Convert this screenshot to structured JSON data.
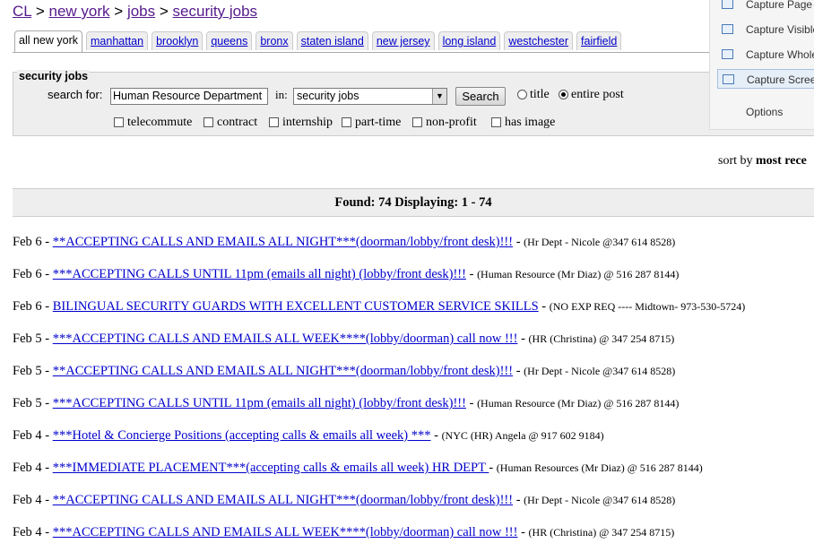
{
  "breadcrumb": {
    "items": [
      "CL",
      "new york",
      "jobs",
      "security jobs"
    ],
    "separator": ">"
  },
  "tabs": [
    {
      "label": "all new york",
      "active": true
    },
    {
      "label": "manhattan"
    },
    {
      "label": "brooklyn"
    },
    {
      "label": "queens"
    },
    {
      "label": "bronx"
    },
    {
      "label": "staten island"
    },
    {
      "label": "new jersey"
    },
    {
      "label": "long island"
    },
    {
      "label": "westchester"
    },
    {
      "label": "fairfield"
    }
  ],
  "search": {
    "panel_title": "security jobs",
    "label": "search for:",
    "query": "Human Resource Department",
    "in_label": "in:",
    "category": "security jobs",
    "button": "Search",
    "radio_title": "title",
    "radio_entire": "entire post",
    "selected_radio": "entire post",
    "filters": [
      "telecommute",
      "contract",
      "internship",
      "part-time",
      "non-profit",
      "has image"
    ]
  },
  "capture_menu": {
    "items": [
      "Capture Page",
      "Capture Visible",
      "Capture Whole",
      "Capture Screen"
    ],
    "options": "Options"
  },
  "sort": {
    "label": "sort by",
    "value": "most rece"
  },
  "found": "Found: 74 Displaying: 1 - 74",
  "listings": [
    {
      "date": "Feb 6",
      "title": "**ACCEPTING CALLS AND EMAILS ALL NIGHT***(doorman/lobby/front desk)!!!",
      "poster": "(Hr Dept - Nicole @347 614 8528)"
    },
    {
      "date": "Feb 6",
      "title": "***ACCEPTING CALLS UNTIL 11pm (emails all night) (lobby/front desk)!!!",
      "poster": "(Human Resource (Mr Diaz) @ 516 287 8144)"
    },
    {
      "date": "Feb 6",
      "title": "BILINGUAL SECURITY GUARDS WITH EXCELLENT CUSTOMER SERVICE SKILLS",
      "poster": "(NO EXP REQ ---- Midtown- 973-530-5724)"
    },
    {
      "date": "Feb 5",
      "title": "***ACCEPTING CALLS AND EMAILS ALL WEEK****(lobby/doorman) call now !!!",
      "poster": "(HR (Christina) @ 347 254 8715)"
    },
    {
      "date": "Feb 5",
      "title": "**ACCEPTING CALLS AND EMAILS ALL NIGHT***(doorman/lobby/front desk)!!!",
      "poster": "(Hr Dept - Nicole @347 614 8528)"
    },
    {
      "date": "Feb 5",
      "title": "***ACCEPTING CALLS UNTIL 11pm (emails all night) (lobby/front desk)!!!",
      "poster": "(Human Resource (Mr Diaz) @ 516 287 8144)"
    },
    {
      "date": "Feb 4",
      "title": "***Hotel & Concierge Positions (accepting calls & emails all week) ***",
      "poster": "(NYC (HR) Angela @ 917 602 9184)"
    },
    {
      "date": "Feb 4",
      "title": "***IMMEDIATE PLACEMENT***(accepting calls & emails all week) HR DEPT ",
      "poster": "(Human Resources (Mr Diaz) @ 516 287 8144)"
    },
    {
      "date": "Feb 4",
      "title": "**ACCEPTING CALLS AND EMAILS ALL NIGHT***(doorman/lobby/front desk)!!!",
      "poster": "(Hr Dept - Nicole @347 614 8528)"
    },
    {
      "date": "Feb 4",
      "title": "***ACCEPTING CALLS AND EMAILS ALL WEEK****(lobby/doorman) call now !!!",
      "poster": "(HR (Christina) @ 347 254 8715)"
    }
  ],
  "colors": {
    "link": "#0000cc",
    "visited": "#551a8b",
    "panel_bg": "#eeeeee"
  }
}
